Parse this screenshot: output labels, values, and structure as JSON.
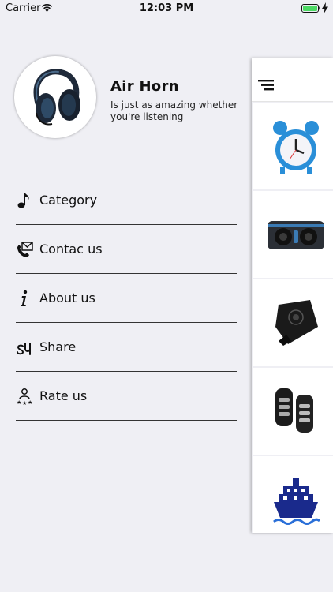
{
  "status_bar": {
    "carrier": "Carrier",
    "time": "12:03 PM"
  },
  "profile": {
    "title": "Air Horn",
    "subtitle": "Is just as amazing whether you're listening"
  },
  "menu": {
    "items": [
      {
        "label": "Category",
        "icon": "music-note-icon"
      },
      {
        "label": "Contac us",
        "icon": "phone-mail-icon"
      },
      {
        "label": "About us",
        "icon": "info-icon"
      },
      {
        "label": "Share",
        "icon": "share-icon"
      },
      {
        "label": "Rate us",
        "icon": "rate-icon"
      }
    ]
  },
  "main_panel": {
    "cards": [
      {
        "icon": "alarm-clock-icon"
      },
      {
        "icon": "speaker-icon"
      },
      {
        "icon": "pager-icon"
      },
      {
        "icon": "car-remote-icon"
      },
      {
        "icon": "ship-icon"
      }
    ]
  },
  "colors": {
    "background": "#efeff4",
    "battery": "#4cd964",
    "ship": "#1a2a8c",
    "clock": "#2a8fd8"
  }
}
